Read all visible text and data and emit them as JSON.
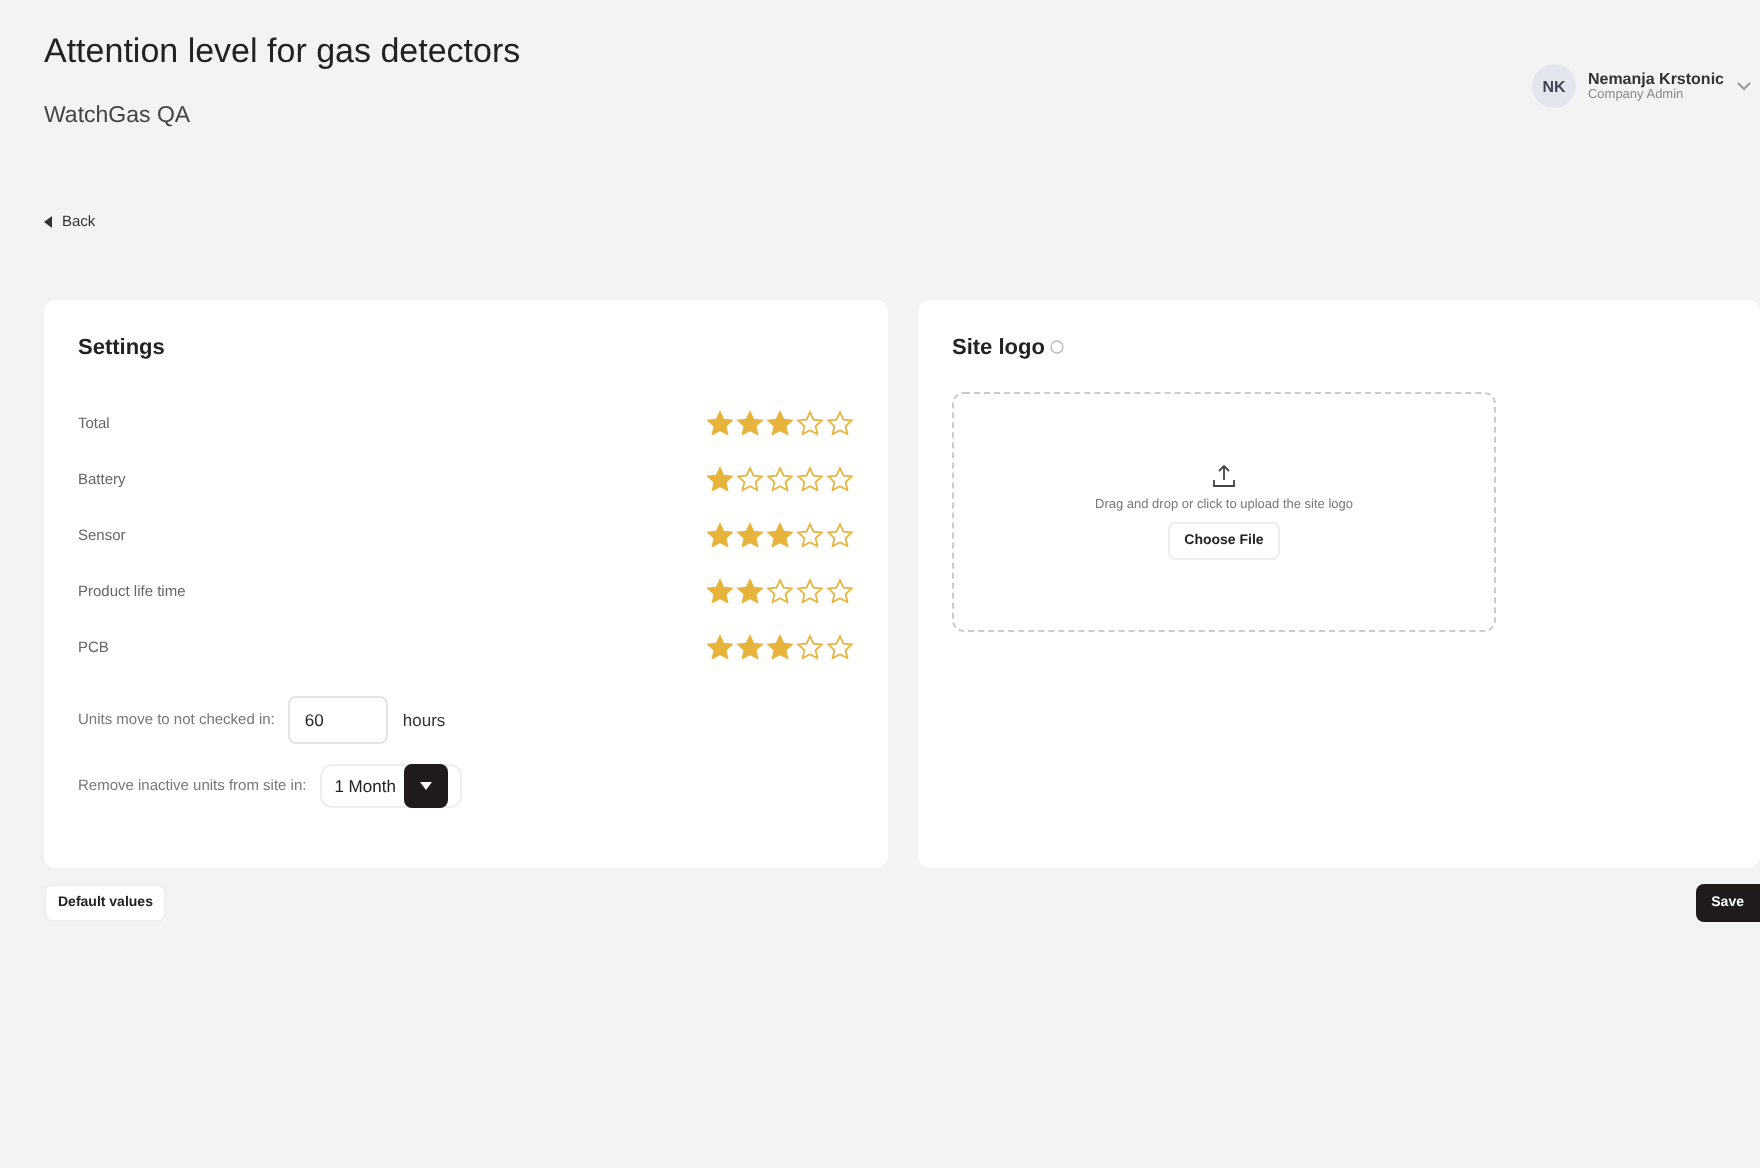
{
  "header": {
    "title": "Attention level for gas detectors",
    "subtitle": "WatchGas QA"
  },
  "user": {
    "initials": "NK",
    "name": "Nemanja Krstonic",
    "role": "Company Admin"
  },
  "back": {
    "label": "Back"
  },
  "settings": {
    "title": "Settings",
    "ratings": [
      {
        "label": "Total",
        "stars": 3
      },
      {
        "label": "Battery",
        "stars": 1
      },
      {
        "label": "Sensor",
        "stars": 3
      },
      {
        "label": "Product life time",
        "stars": 2
      },
      {
        "label": "PCB",
        "stars": 3
      }
    ],
    "units_field": {
      "label": "Units move to not checked in:",
      "value": "60",
      "unit": "hours"
    },
    "remove_select": {
      "label": "Remove inactive units from site in:",
      "value": "1 Month"
    }
  },
  "site_logo": {
    "title": "Site logo",
    "hint": "Drag and drop or click to upload the site logo",
    "button": "Choose File"
  },
  "buttons": {
    "default": "Default values",
    "save": "Save"
  }
}
